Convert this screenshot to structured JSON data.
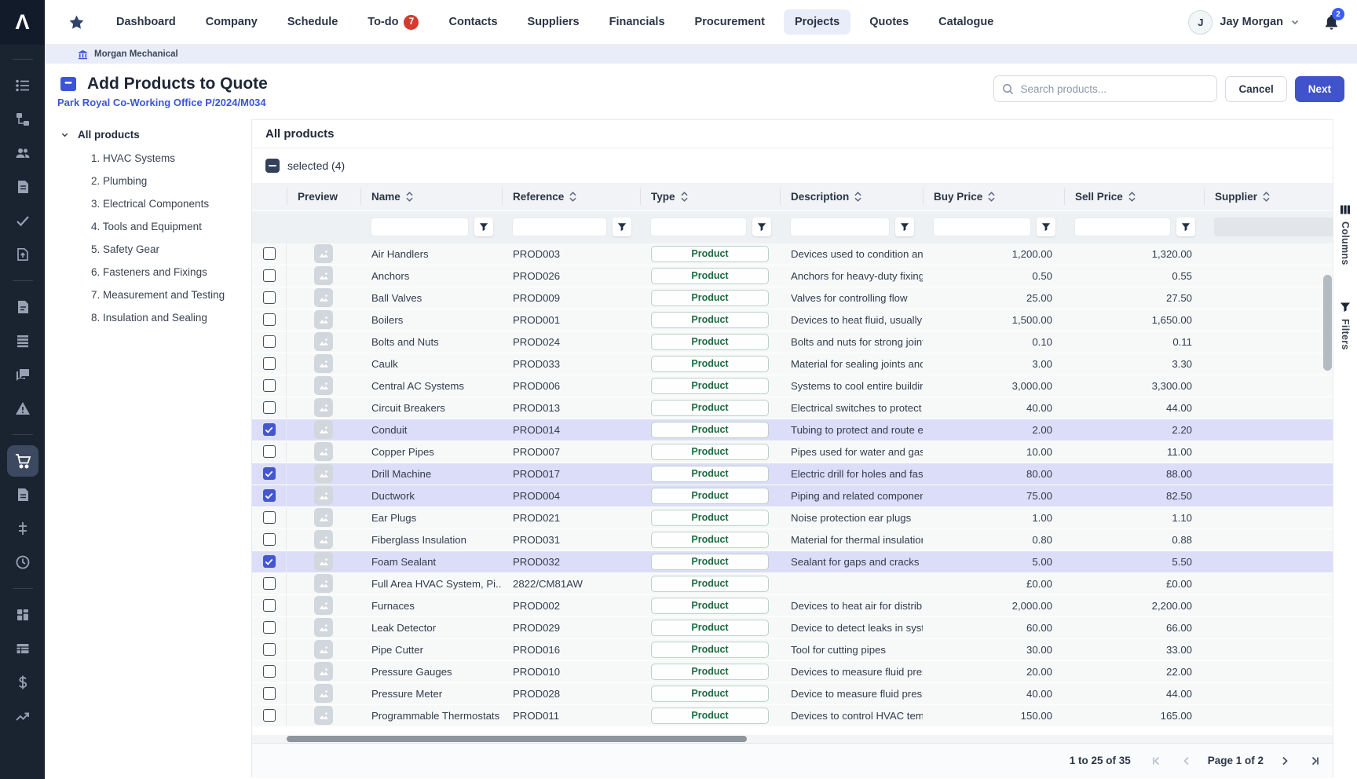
{
  "topnav": {
    "logo_glyph": "Λ",
    "items": [
      {
        "label": "Dashboard"
      },
      {
        "label": "Company"
      },
      {
        "label": "Schedule"
      },
      {
        "label": "To-do",
        "badge": "7"
      },
      {
        "label": "Contacts"
      },
      {
        "label": "Suppliers"
      },
      {
        "label": "Financials"
      },
      {
        "label": "Procurement"
      },
      {
        "label": "Projects",
        "active": true
      },
      {
        "label": "Quotes"
      },
      {
        "label": "Catalogue"
      }
    ],
    "user": {
      "initial": "J",
      "name": "Jay Morgan"
    },
    "notifications_badge": "2"
  },
  "breadcrumb": {
    "company": "Morgan Mechanical"
  },
  "header": {
    "title": "Add Products to Quote",
    "subtitle_link": "Park Royal Co-Working Office P/2024/M034",
    "search_placeholder": "Search products...",
    "cancel_label": "Cancel",
    "next_label": "Next"
  },
  "sidebar": {
    "icons": [
      "list",
      "hierarchy",
      "users",
      "document",
      "check",
      "file-upload",
      "document-lines",
      "rows",
      "chat",
      "warning",
      "cart",
      "invoice",
      "adjustments",
      "clock",
      "grid",
      "table",
      "dollar",
      "trend"
    ],
    "active_icon": "cart"
  },
  "tree": {
    "root": "All products",
    "children": [
      "1. HVAC Systems",
      "2. Plumbing",
      "3. Electrical Components",
      "4. Tools and Equipment",
      "5. Safety Gear",
      "6. Fasteners and Fixings",
      "7. Measurement and Testing",
      "8. Insulation and Sealing"
    ]
  },
  "main": {
    "section_title": "All products",
    "selected_label": "selected (4)"
  },
  "table": {
    "columns": [
      {
        "label": ""
      },
      {
        "label": "Preview",
        "sortable": false
      },
      {
        "label": "Name",
        "sortable": true
      },
      {
        "label": "Reference",
        "sortable": true
      },
      {
        "label": "Type",
        "sortable": true
      },
      {
        "label": "Description",
        "sortable": true
      },
      {
        "label": "Buy Price",
        "sortable": true
      },
      {
        "label": "Sell Price",
        "sortable": true
      },
      {
        "label": "Supplier",
        "sortable": true
      }
    ],
    "rows": [
      {
        "name": "Air Handlers",
        "reference": "PROD003",
        "type": "Product",
        "description": "Devices used to condition and c",
        "buy": "1,200.00",
        "sell": "1,320.00",
        "supplier": "",
        "selected": false
      },
      {
        "name": "Anchors",
        "reference": "PROD026",
        "type": "Product",
        "description": "Anchors for heavy-duty fixings",
        "buy": "0.50",
        "sell": "0.55",
        "supplier": "",
        "selected": false
      },
      {
        "name": "Ball Valves",
        "reference": "PROD009",
        "type": "Product",
        "description": "Valves for controlling flow",
        "buy": "25.00",
        "sell": "27.50",
        "supplier": "",
        "selected": false
      },
      {
        "name": "Boilers",
        "reference": "PROD001",
        "type": "Product",
        "description": "Devices to heat fluid, usually wo",
        "buy": "1,500.00",
        "sell": "1,650.00",
        "supplier": "",
        "selected": false
      },
      {
        "name": "Bolts and Nuts",
        "reference": "PROD024",
        "type": "Product",
        "description": "Bolts and nuts for strong joints",
        "buy": "0.10",
        "sell": "0.11",
        "supplier": "",
        "selected": false
      },
      {
        "name": "Caulk",
        "reference": "PROD033",
        "type": "Product",
        "description": "Material for sealing joints and se",
        "buy": "3.00",
        "sell": "3.30",
        "supplier": "",
        "selected": false
      },
      {
        "name": "Central AC Systems",
        "reference": "PROD006",
        "type": "Product",
        "description": "Systems to cool entire buildings",
        "buy": "3,000.00",
        "sell": "3,300.00",
        "supplier": "",
        "selected": false
      },
      {
        "name": "Circuit Breakers",
        "reference": "PROD013",
        "type": "Product",
        "description": "Electrical switches to protect cir",
        "buy": "40.00",
        "sell": "44.00",
        "supplier": "",
        "selected": false
      },
      {
        "name": "Conduit",
        "reference": "PROD014",
        "type": "Product",
        "description": "Tubing to protect and route elec",
        "buy": "2.00",
        "sell": "2.20",
        "supplier": "",
        "selected": true
      },
      {
        "name": "Copper Pipes",
        "reference": "PROD007",
        "type": "Product",
        "description": "Pipes used for water and gas di",
        "buy": "10.00",
        "sell": "11.00",
        "supplier": "",
        "selected": false
      },
      {
        "name": "Drill Machine",
        "reference": "PROD017",
        "type": "Product",
        "description": "Electric drill for holes and faster",
        "buy": "80.00",
        "sell": "88.00",
        "supplier": "",
        "selected": true
      },
      {
        "name": "Ductwork",
        "reference": "PROD004",
        "type": "Product",
        "description": "Piping and related components",
        "buy": "75.00",
        "sell": "82.50",
        "supplier": "",
        "selected": true
      },
      {
        "name": "Ear Plugs",
        "reference": "PROD021",
        "type": "Product",
        "description": "Noise protection ear plugs",
        "buy": "1.00",
        "sell": "1.10",
        "supplier": "",
        "selected": false
      },
      {
        "name": "Fiberglass Insulation",
        "reference": "PROD031",
        "type": "Product",
        "description": "Material for thermal insulation",
        "buy": "0.80",
        "sell": "0.88",
        "supplier": "",
        "selected": false
      },
      {
        "name": "Foam Sealant",
        "reference": "PROD032",
        "type": "Product",
        "description": "Sealant for gaps and cracks",
        "buy": "5.00",
        "sell": "5.50",
        "supplier": "",
        "selected": true
      },
      {
        "name": "Full Area HVAC System, Pi...",
        "reference": "2822/CM81AW",
        "type": "Product",
        "description": "",
        "buy": "£0.00",
        "sell": "£0.00",
        "supplier": "",
        "selected": false
      },
      {
        "name": "Furnaces",
        "reference": "PROD002",
        "type": "Product",
        "description": "Devices to heat air for distributi",
        "buy": "2,000.00",
        "sell": "2,200.00",
        "supplier": "",
        "selected": false
      },
      {
        "name": "Leak Detector",
        "reference": "PROD029",
        "type": "Product",
        "description": "Device to detect leaks in system",
        "buy": "60.00",
        "sell": "66.00",
        "supplier": "",
        "selected": false
      },
      {
        "name": "Pipe Cutter",
        "reference": "PROD016",
        "type": "Product",
        "description": "Tool for cutting pipes",
        "buy": "30.00",
        "sell": "33.00",
        "supplier": "",
        "selected": false
      },
      {
        "name": "Pressure Gauges",
        "reference": "PROD010",
        "type": "Product",
        "description": "Devices to measure fluid pressu",
        "buy": "20.00",
        "sell": "22.00",
        "supplier": "",
        "selected": false
      },
      {
        "name": "Pressure Meter",
        "reference": "PROD028",
        "type": "Product",
        "description": "Device to measure fluid pressur",
        "buy": "40.00",
        "sell": "44.00",
        "supplier": "",
        "selected": false
      },
      {
        "name": "Programmable Thermostats",
        "reference": "PROD011",
        "type": "Product",
        "description": "Devices to control HVAC temper",
        "buy": "150.00",
        "sell": "165.00",
        "supplier": "",
        "selected": false
      }
    ]
  },
  "right_rail": {
    "tabs": [
      {
        "label": "Columns"
      },
      {
        "label": "Filters"
      }
    ]
  },
  "pagination": {
    "range": "1 to 25 of 35",
    "page_label": "Page 1 of 2"
  },
  "colors": {
    "accent": "#4053cb",
    "selected_row": "#dcddf8",
    "badge_green": "#1f6b42",
    "danger": "#d6392f",
    "rail_bg": "#1a2330",
    "crumb_bg": "#e9edf9"
  }
}
